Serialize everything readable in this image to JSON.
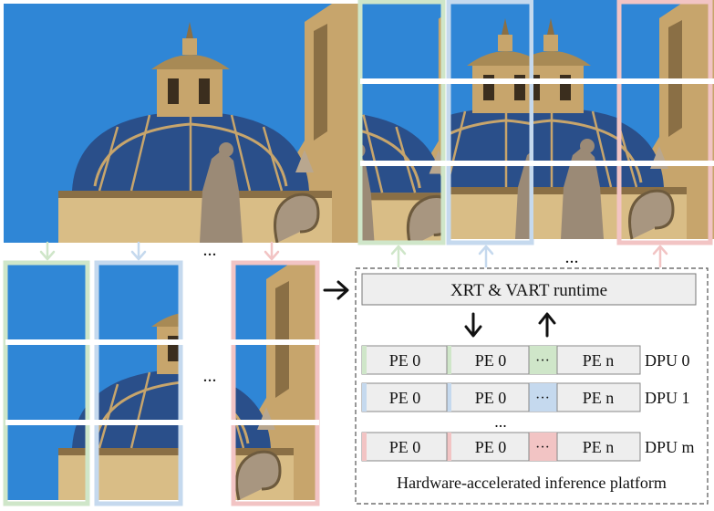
{
  "colors": {
    "sky": "#2f86d6",
    "stone": "#c7a56c",
    "stone_dark": "#6d5a3d",
    "tile": "#2a4f8a",
    "green": "#cfe6c9",
    "blue": "#c5d9ee",
    "red": "#f2c4c4",
    "runtime_fill": "#eeeeee",
    "pe_fill": "#eeeeee"
  },
  "diagram": {
    "ellipsis": "...",
    "runtime_label": "XRT & VART runtime",
    "platform_label": "Hardware-accelerated inference platform",
    "dpus": [
      {
        "pe_labels": [
          "PE 0",
          "PE 0",
          "PE n"
        ],
        "dots": "···",
        "name": "DPU 0",
        "accent": "green"
      },
      {
        "pe_labels": [
          "PE 0",
          "PE 0",
          "PE n"
        ],
        "dots": "···",
        "name": "DPU 1",
        "accent": "blue"
      },
      {
        "pe_labels": [
          "PE 0",
          "PE 0",
          "PE n"
        ],
        "dots": "···",
        "name": "DPU m",
        "accent": "red"
      }
    ],
    "icons": {
      "down_arrow": "arrow-down-icon",
      "up_arrow": "arrow-up-icon",
      "right_arrow": "arrow-right-icon"
    }
  }
}
